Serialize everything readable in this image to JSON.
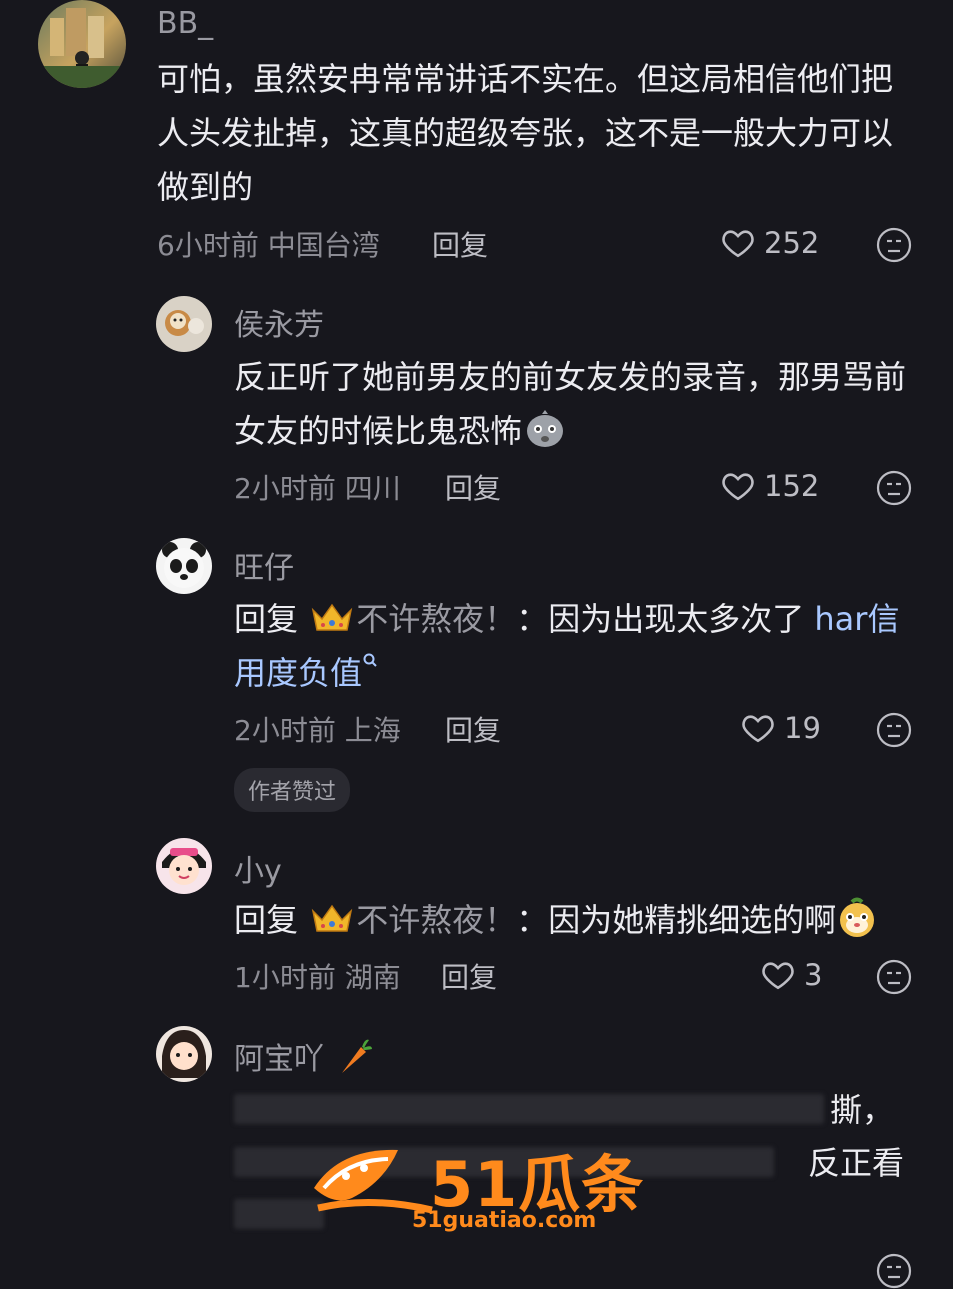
{
  "comments": [
    {
      "name": "BB_",
      "text": "可怕，虽然安冉常常讲话不实在。但这局相信他们把人头发扯掉，这真的超级夸张，这不是一般大力可以做到的",
      "time": "6小时前",
      "location": "中国台湾",
      "reply_label": "回复",
      "likes": "252"
    },
    {
      "name": "侯永芳",
      "text": "反正听了她前男友的前女友发的录音，那男骂前女友的时候比鬼恐怖",
      "time": "2小时前",
      "location": "四川",
      "reply_label": "回复",
      "likes": "152"
    },
    {
      "name": "旺仔",
      "reply_prefix": "回复",
      "reply_to": "不许熬夜！",
      "text": "：因为出现太多次了",
      "link_text": "har信用度负值",
      "time": "2小时前",
      "location": "上海",
      "reply_label": "回复",
      "likes": "19",
      "badge": "作者赞过"
    },
    {
      "name": "小y",
      "reply_prefix": "回复",
      "reply_to": "不许熬夜！",
      "text": "：因为她精挑细选的啊",
      "time": "1小时前",
      "location": "湖南",
      "reply_label": "回复",
      "likes": "3"
    },
    {
      "name": "阿宝吖",
      "visible_fragment_1": "撕，",
      "visible_fragment_2": "反正看"
    }
  ],
  "watermark": {
    "brand": "51瓜条",
    "url": "51guatiao.com"
  },
  "colors": {
    "background": "#17171d",
    "text": "#ececf1",
    "muted": "#8c8c94",
    "link": "#a9c8ff",
    "watermark": "#ff8a1c"
  }
}
